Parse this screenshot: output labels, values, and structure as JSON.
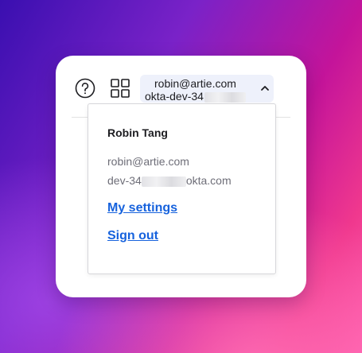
{
  "toolbar": {
    "help_icon": "help-circle-icon",
    "apps_icon": "apps-grid-icon",
    "account": {
      "email": "robin@artie.com",
      "org_prefix": "okta-dev-34",
      "org_redacted": true,
      "chevron_icon": "chevron-up-icon"
    }
  },
  "dropdown": {
    "user_name": "Robin Tang",
    "user_email": "robin@artie.com",
    "domain_prefix": "dev-34",
    "domain_suffix": "okta.com",
    "links": {
      "settings": "My settings",
      "signout": "Sign out"
    }
  },
  "colors": {
    "link": "#1662dd",
    "text": "#1d1d21",
    "muted": "#6e6e78",
    "account_bg": "#eef1fb"
  }
}
